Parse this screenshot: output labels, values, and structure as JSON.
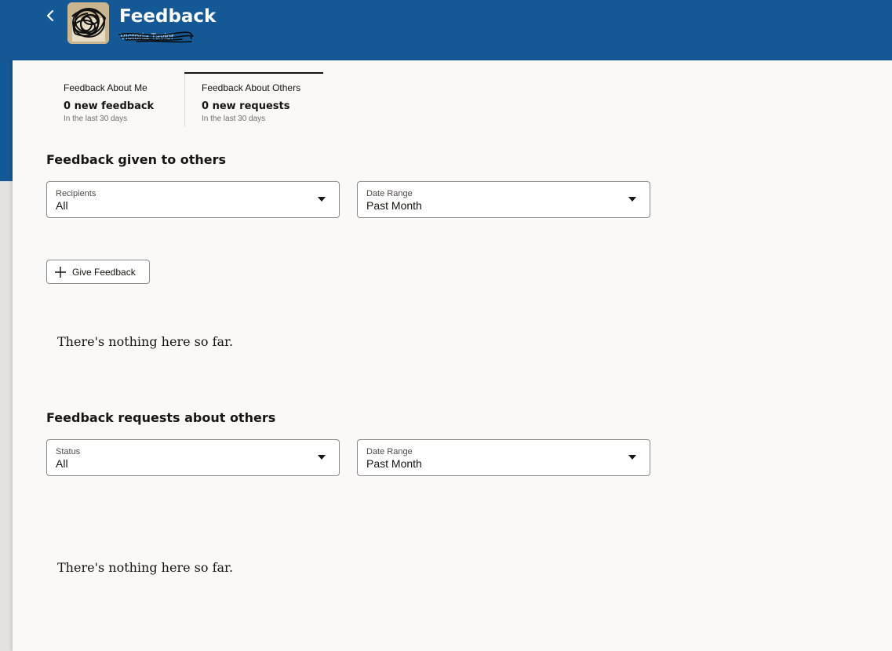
{
  "header": {
    "title": "Feedback",
    "subtitle": "Victoria Taylor",
    "back_icon": "chevron-left-icon",
    "avatar_icon": "user-photo"
  },
  "tabs": [
    {
      "label": "Feedback About Me",
      "value": "0 new feedback",
      "caption": "In the last 30 days",
      "active": false
    },
    {
      "label": "Feedback About Others",
      "value": "0 new requests",
      "caption": "In the last 30 days",
      "active": true
    }
  ],
  "given": {
    "title": "Feedback given to others",
    "filters": [
      {
        "label": "Recipients",
        "value": "All"
      },
      {
        "label": "Date Range",
        "value": "Past Month"
      }
    ],
    "give_button": {
      "label": "Give Feedback",
      "icon": "plus-icon"
    },
    "empty_message": "There's nothing here so far."
  },
  "requests": {
    "title": "Feedback requests about others",
    "filters": [
      {
        "label": "Status",
        "value": "All"
      },
      {
        "label": "Date Range",
        "value": "Past Month"
      }
    ],
    "empty_message": "There's nothing here so far."
  },
  "colors": {
    "header_bg": "#145896",
    "panel_bg": "#fbf9f8",
    "text": "#161513"
  }
}
